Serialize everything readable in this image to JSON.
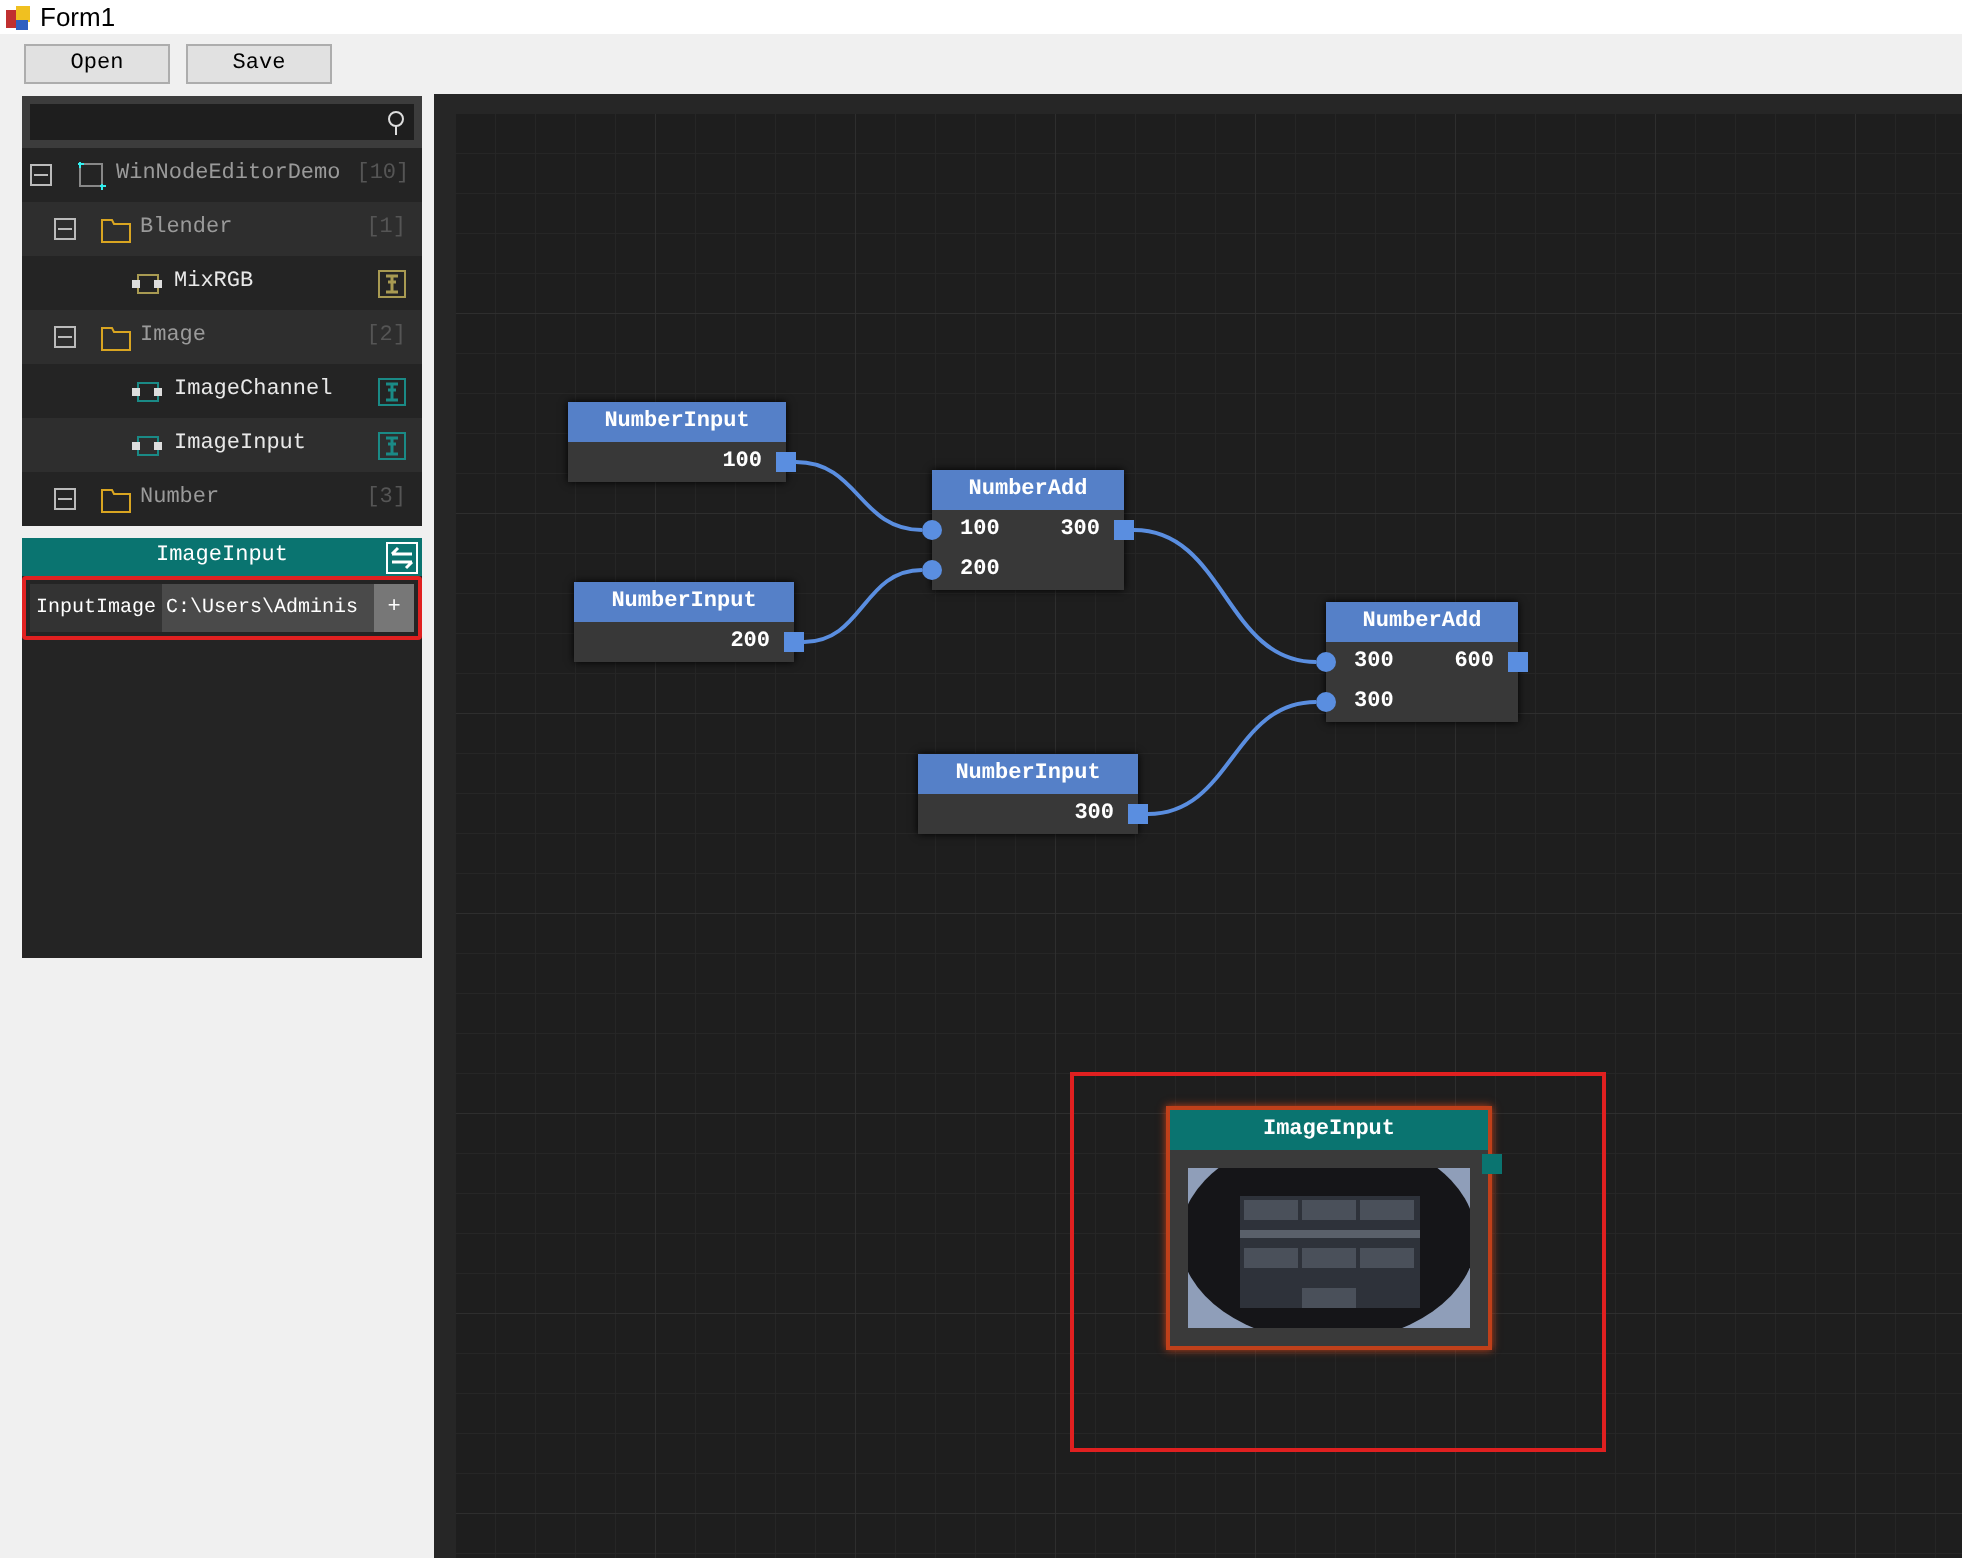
{
  "window": {
    "title": "Form1"
  },
  "toolbar": [
    "Open",
    "Save"
  ],
  "tree": {
    "items": [
      {
        "label": "WinNodeEditorDemo",
        "kind": "root",
        "count": "[10]",
        "expanded": true,
        "children": [
          {
            "label": "Blender",
            "kind": "folder",
            "count": "[1]",
            "expanded": true,
            "children": [
              {
                "label": "MixRGB",
                "kind": "node",
                "color": "#a89a52"
              }
            ]
          },
          {
            "label": "Image",
            "kind": "folder",
            "count": "[2]",
            "expanded": true,
            "children": [
              {
                "label": "ImageChannel",
                "kind": "node",
                "color": "#1a8a86"
              },
              {
                "label": "ImageInput",
                "kind": "node",
                "color": "#1a8a86"
              }
            ]
          },
          {
            "label": "Number",
            "kind": "folder",
            "count": "[3]",
            "expanded": true
          }
        ]
      }
    ]
  },
  "properties": {
    "title": "ImageInput",
    "rows": [
      {
        "label": "InputImage",
        "value": "C:\\Users\\Adminis",
        "button": "+",
        "highlighted": true
      }
    ]
  },
  "canvas": {
    "nodes": [
      {
        "kind": "number",
        "title": "NumberInput",
        "color": "#5580c8",
        "outputs": [
          "100"
        ]
      },
      {
        "kind": "number",
        "title": "NumberInput",
        "color": "#5580c8",
        "outputs": [
          "200"
        ]
      },
      {
        "kind": "number",
        "title": "NumberAdd",
        "color": "#5580c8",
        "inputs": [
          "100",
          "200"
        ],
        "outputs": [
          "300"
        ]
      },
      {
        "kind": "number",
        "title": "NumberAdd",
        "color": "#5580c8",
        "inputs": [
          "300",
          "300"
        ],
        "outputs": [
          "600"
        ]
      },
      {
        "kind": "number",
        "title": "NumberInput",
        "color": "#5580c8",
        "outputs": [
          "300"
        ]
      },
      {
        "title": "ImageInput",
        "color": "#0a7470",
        "highlighted": true
      }
    ]
  }
}
